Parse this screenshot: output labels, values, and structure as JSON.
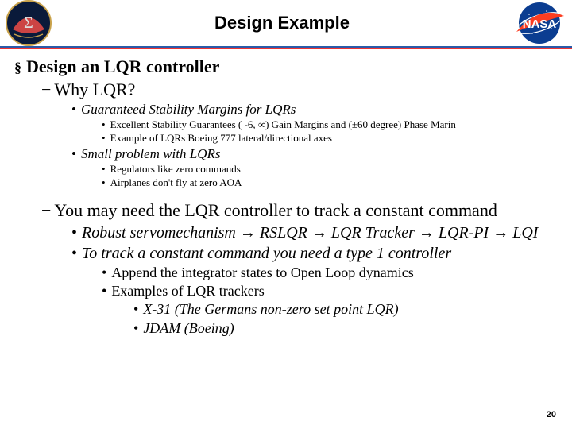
{
  "header": {
    "title": "Design Example"
  },
  "content": {
    "s1": "Design an LQR controller",
    "s1a": "Why LQR?",
    "s1a1": "Guaranteed Stability Margins for LQRs",
    "s1a1a": "Excellent Stability Guarantees ( -6, ∞) Gain Margins and (±60 degree) Phase Marin",
    "s1a1b": "Example of LQRs Boeing 777 lateral/directional axes",
    "s1a2": "Small problem with LQRs",
    "s1a2a": "Regulators like zero commands",
    "s1a2b": "Airplanes don't fly at zero AOA",
    "s1b": "You may need the LQR controller to track a constant command",
    "s1b1_pre": "Robust servomechanism ",
    "s1b1_chain": " RSLQR → LQR Tracker → LQR-PI → LQI",
    "s1b2": "To track a constant command you need a type 1 controller",
    "s1b2a": "Append the integrator states to Open Loop dynamics",
    "s1b2b": "Examples of LQR trackers",
    "s1b2b1": "X-31  (The Germans non-zero set point LQR)",
    "s1b2b2": "JDAM (Boeing)"
  },
  "page_number": "20"
}
